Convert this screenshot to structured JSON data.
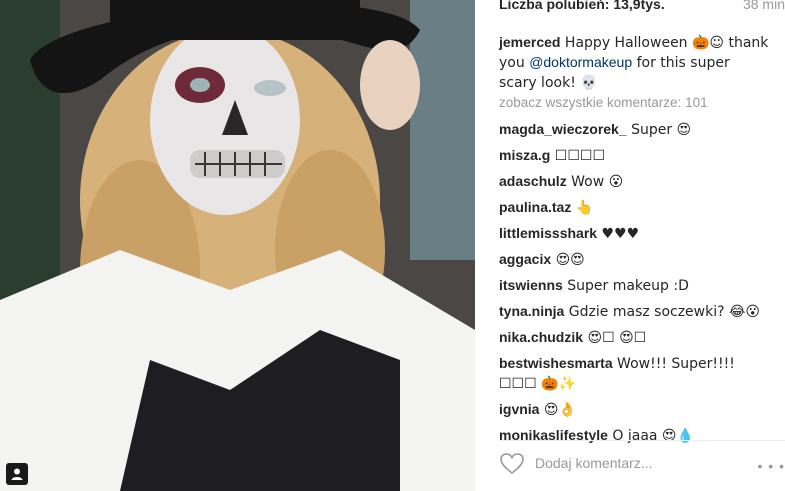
{
  "post": {
    "likes_label": "Liczba polubień: 13,9tys.",
    "time": "38 min"
  },
  "caption": {
    "user": "jemerced",
    "text_before": " Happy Halloween 🎃☺ thank you ",
    "mention": "@doktormakeup",
    "text_after": " for this super scary look! 💀"
  },
  "view_all": "zobacz wszystkie komentarze: 101",
  "comments": [
    {
      "user": "magda_wieczorek_",
      "text": " Super 😍"
    },
    {
      "user": "misza.g",
      "text": " ☐☐☐☐"
    },
    {
      "user": "adaschulz",
      "text": " Wow 😮"
    },
    {
      "user": "paulina.taz",
      "text": " 👆"
    },
    {
      "user": "littlemissshark",
      "text": " ♥♥♥"
    },
    {
      "user": "aggacix",
      "text": " 😍😍"
    },
    {
      "user": "itswienns",
      "text": " Super makeup :D"
    },
    {
      "user": "tyna.ninja",
      "text": " Gdzie masz soczewki? 😂😮"
    },
    {
      "user": "nika.chudzik",
      "text": " 😍☐ 😍☐"
    },
    {
      "user": "bestwishesmarta",
      "text": " Wow!!! Super!!!! ☐☐☐ 🎃✨"
    },
    {
      "user": "igvnia",
      "text": " 😍👌"
    },
    {
      "user": "monikaslifestyle",
      "text": " O jaaa 😍💧"
    }
  ],
  "footer": {
    "add_comment_placeholder": "Dodaj komentarz...",
    "more_label": "• • •"
  }
}
